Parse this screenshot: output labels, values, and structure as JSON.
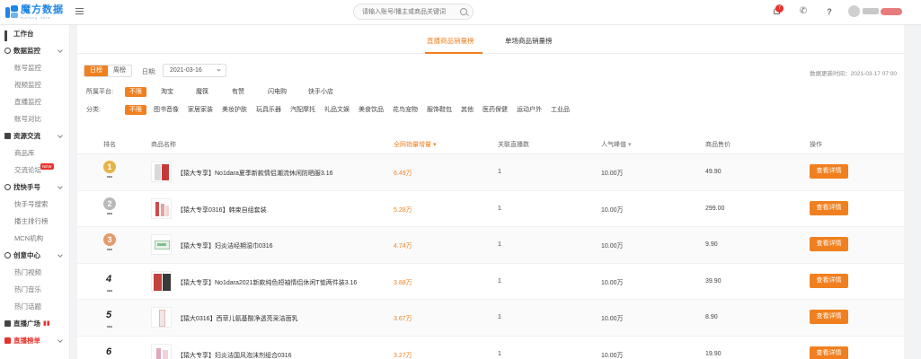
{
  "brand": {
    "name": "魔方数据",
    "sub": "mofang data",
    "accent": "#1e86e6"
  },
  "header": {
    "search_placeholder": "请输入账号/播主或商品关键词",
    "notification_count": "7"
  },
  "sidebar": {
    "groups": [
      {
        "label": "工作台",
        "icon": "grid-icon",
        "items": []
      },
      {
        "label": "数据监控",
        "icon": "monitor-icon",
        "items": [
          "账号监控",
          "视频监控",
          "直播监控",
          "账号对比"
        ]
      },
      {
        "label": "资源交流",
        "icon": "exchange-icon",
        "items": [
          "商品库",
          "交流论坛"
        ]
      },
      {
        "label": "找快手号",
        "icon": "search-account-icon",
        "items": [
          "快手号搜索",
          "播主排行榜",
          "MCN机构"
        ]
      },
      {
        "label": "创意中心",
        "icon": "creative-icon",
        "items": [
          "热门视频",
          "热门音乐",
          "热门话题"
        ]
      },
      {
        "label": "直播广场",
        "icon": "live-icon",
        "items": []
      },
      {
        "label": "直播榜单",
        "icon": "ranking-icon",
        "items": []
      }
    ],
    "new_badge": "NEW"
  },
  "tabs": [
    {
      "label": "直播商品销量榜",
      "active": true
    },
    {
      "label": "单场商品销量榜",
      "active": false
    }
  ],
  "filters": {
    "period_options": [
      "日榜",
      "周榜"
    ],
    "period_selected": "日榜",
    "date_label": "日期:",
    "date_value": "2021-03-16",
    "updated": "数据更新时间：2021-03-17 07:00",
    "platform_label": "所属平台:",
    "platforms": [
      "不限",
      "淘宝",
      "魔筷",
      "有赞",
      "闪电购",
      "快手小店"
    ],
    "category_label": "分类:",
    "categories": [
      "不限",
      "图书音像",
      "家居家装",
      "美妆护肤",
      "玩具乐器",
      "汽配摩托",
      "礼品文娱",
      "美食饮品",
      "花鸟宠物",
      "服饰鞋包",
      "其他",
      "医药保健",
      "运动户外",
      "工业品"
    ]
  },
  "table": {
    "headers": [
      "排名",
      "商品名称",
      "全网销量增量",
      "关联直播数",
      "人气峰值",
      "商品售价",
      "操作"
    ],
    "rows": [
      {
        "rank": "1",
        "name": "【猿大专享】No1dara夏季新款情侣潮流休闲防晒服3.16",
        "sales": "6.49万",
        "lives": "1",
        "peak": "10.00万",
        "price": "49.90"
      },
      {
        "rank": "2",
        "name": "【猿大专享0316】韩束自组套装",
        "sales": "5.28万",
        "lives": "1",
        "peak": "10.00万",
        "price": "299.00"
      },
      {
        "rank": "3",
        "name": "【猿大专享】妇炎洁经期湿巾0316",
        "sales": "4.74万",
        "lives": "1",
        "peak": "10.00万",
        "price": "9.90"
      },
      {
        "rank": "4",
        "name": "【猿大专享】No1dara2021新款纯色短袖情侣休闲T恤两件装3.16",
        "sales": "3.88万",
        "lives": "1",
        "peak": "10.00万",
        "price": "39.90"
      },
      {
        "rank": "5",
        "name": "【猿大0316】西菲儿氨基酸净透亮采洁面乳",
        "sales": "3.67万",
        "lives": "1",
        "peak": "10.00万",
        "price": "8.90"
      },
      {
        "rank": "6",
        "name": "【猿大专享】妇炎洁国风泡沫剂组合0316",
        "sales": "3.27万",
        "lives": "1",
        "peak": "10.00万",
        "price": "19.90"
      }
    ],
    "detail_label": "查看详情"
  },
  "colors": {
    "accent": "#f0801f",
    "gold": "#e6b34a",
    "silver": "#b9b9b9",
    "bronze": "#e49a6a"
  }
}
